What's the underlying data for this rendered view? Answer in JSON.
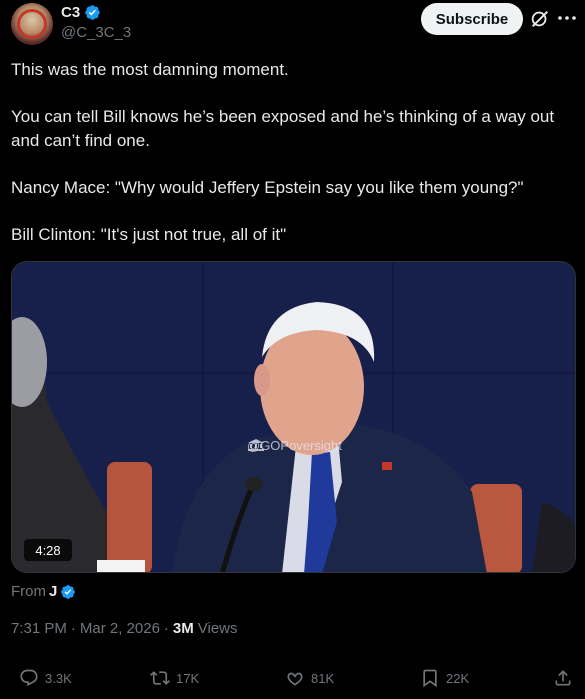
{
  "author": {
    "name": "C3",
    "handle": "@C_3C_3",
    "verified": true
  },
  "header": {
    "subscribe_label": "Subscribe"
  },
  "tweet": {
    "paragraphs": [
      "This was the most damning moment.",
      "You can tell Bill knows he’s been exposed and he’s thinking of a way out and can’t find one.",
      "Nancy Mace: \"Why would Jeffery Epstein say you like them young?\"",
      "Bill Clinton: \"It's just not true, all of it\""
    ]
  },
  "media": {
    "watermark": "@GOPoversight",
    "duration": "4:28"
  },
  "source": {
    "from_label": "From",
    "from_name": "J"
  },
  "meta": {
    "time": "7:31 PM",
    "date": "Mar 2, 2026",
    "views_count": "3M",
    "views_label": "Views"
  },
  "actions": {
    "replies": "3.3K",
    "reposts": "17K",
    "likes": "81K",
    "bookmarks": "22K"
  },
  "colors": {
    "background": "#000000",
    "text": "#e7e9ea",
    "muted": "#71767b",
    "verified": "#1d9bf0"
  }
}
